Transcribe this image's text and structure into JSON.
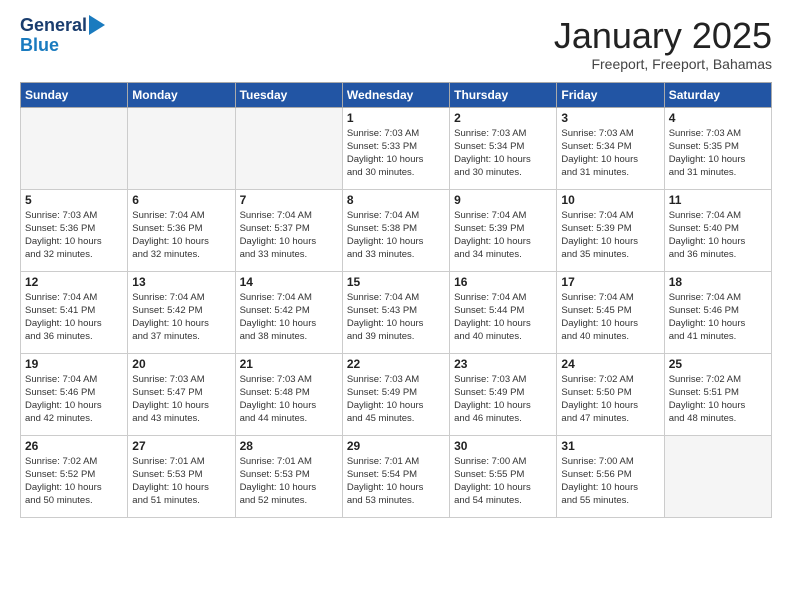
{
  "header": {
    "logo_line1": "General",
    "logo_line2": "Blue",
    "month": "January 2025",
    "location": "Freeport, Freeport, Bahamas"
  },
  "days_of_week": [
    "Sunday",
    "Monday",
    "Tuesday",
    "Wednesday",
    "Thursday",
    "Friday",
    "Saturday"
  ],
  "weeks": [
    [
      {
        "day": "",
        "info": ""
      },
      {
        "day": "",
        "info": ""
      },
      {
        "day": "",
        "info": ""
      },
      {
        "day": "1",
        "info": "Sunrise: 7:03 AM\nSunset: 5:33 PM\nDaylight: 10 hours\nand 30 minutes."
      },
      {
        "day": "2",
        "info": "Sunrise: 7:03 AM\nSunset: 5:34 PM\nDaylight: 10 hours\nand 30 minutes."
      },
      {
        "day": "3",
        "info": "Sunrise: 7:03 AM\nSunset: 5:34 PM\nDaylight: 10 hours\nand 31 minutes."
      },
      {
        "day": "4",
        "info": "Sunrise: 7:03 AM\nSunset: 5:35 PM\nDaylight: 10 hours\nand 31 minutes."
      }
    ],
    [
      {
        "day": "5",
        "info": "Sunrise: 7:03 AM\nSunset: 5:36 PM\nDaylight: 10 hours\nand 32 minutes."
      },
      {
        "day": "6",
        "info": "Sunrise: 7:04 AM\nSunset: 5:36 PM\nDaylight: 10 hours\nand 32 minutes."
      },
      {
        "day": "7",
        "info": "Sunrise: 7:04 AM\nSunset: 5:37 PM\nDaylight: 10 hours\nand 33 minutes."
      },
      {
        "day": "8",
        "info": "Sunrise: 7:04 AM\nSunset: 5:38 PM\nDaylight: 10 hours\nand 33 minutes."
      },
      {
        "day": "9",
        "info": "Sunrise: 7:04 AM\nSunset: 5:39 PM\nDaylight: 10 hours\nand 34 minutes."
      },
      {
        "day": "10",
        "info": "Sunrise: 7:04 AM\nSunset: 5:39 PM\nDaylight: 10 hours\nand 35 minutes."
      },
      {
        "day": "11",
        "info": "Sunrise: 7:04 AM\nSunset: 5:40 PM\nDaylight: 10 hours\nand 36 minutes."
      }
    ],
    [
      {
        "day": "12",
        "info": "Sunrise: 7:04 AM\nSunset: 5:41 PM\nDaylight: 10 hours\nand 36 minutes."
      },
      {
        "day": "13",
        "info": "Sunrise: 7:04 AM\nSunset: 5:42 PM\nDaylight: 10 hours\nand 37 minutes."
      },
      {
        "day": "14",
        "info": "Sunrise: 7:04 AM\nSunset: 5:42 PM\nDaylight: 10 hours\nand 38 minutes."
      },
      {
        "day": "15",
        "info": "Sunrise: 7:04 AM\nSunset: 5:43 PM\nDaylight: 10 hours\nand 39 minutes."
      },
      {
        "day": "16",
        "info": "Sunrise: 7:04 AM\nSunset: 5:44 PM\nDaylight: 10 hours\nand 40 minutes."
      },
      {
        "day": "17",
        "info": "Sunrise: 7:04 AM\nSunset: 5:45 PM\nDaylight: 10 hours\nand 40 minutes."
      },
      {
        "day": "18",
        "info": "Sunrise: 7:04 AM\nSunset: 5:46 PM\nDaylight: 10 hours\nand 41 minutes."
      }
    ],
    [
      {
        "day": "19",
        "info": "Sunrise: 7:04 AM\nSunset: 5:46 PM\nDaylight: 10 hours\nand 42 minutes."
      },
      {
        "day": "20",
        "info": "Sunrise: 7:03 AM\nSunset: 5:47 PM\nDaylight: 10 hours\nand 43 minutes."
      },
      {
        "day": "21",
        "info": "Sunrise: 7:03 AM\nSunset: 5:48 PM\nDaylight: 10 hours\nand 44 minutes."
      },
      {
        "day": "22",
        "info": "Sunrise: 7:03 AM\nSunset: 5:49 PM\nDaylight: 10 hours\nand 45 minutes."
      },
      {
        "day": "23",
        "info": "Sunrise: 7:03 AM\nSunset: 5:49 PM\nDaylight: 10 hours\nand 46 minutes."
      },
      {
        "day": "24",
        "info": "Sunrise: 7:02 AM\nSunset: 5:50 PM\nDaylight: 10 hours\nand 47 minutes."
      },
      {
        "day": "25",
        "info": "Sunrise: 7:02 AM\nSunset: 5:51 PM\nDaylight: 10 hours\nand 48 minutes."
      }
    ],
    [
      {
        "day": "26",
        "info": "Sunrise: 7:02 AM\nSunset: 5:52 PM\nDaylight: 10 hours\nand 50 minutes."
      },
      {
        "day": "27",
        "info": "Sunrise: 7:01 AM\nSunset: 5:53 PM\nDaylight: 10 hours\nand 51 minutes."
      },
      {
        "day": "28",
        "info": "Sunrise: 7:01 AM\nSunset: 5:53 PM\nDaylight: 10 hours\nand 52 minutes."
      },
      {
        "day": "29",
        "info": "Sunrise: 7:01 AM\nSunset: 5:54 PM\nDaylight: 10 hours\nand 53 minutes."
      },
      {
        "day": "30",
        "info": "Sunrise: 7:00 AM\nSunset: 5:55 PM\nDaylight: 10 hours\nand 54 minutes."
      },
      {
        "day": "31",
        "info": "Sunrise: 7:00 AM\nSunset: 5:56 PM\nDaylight: 10 hours\nand 55 minutes."
      },
      {
        "day": "",
        "info": ""
      }
    ]
  ]
}
